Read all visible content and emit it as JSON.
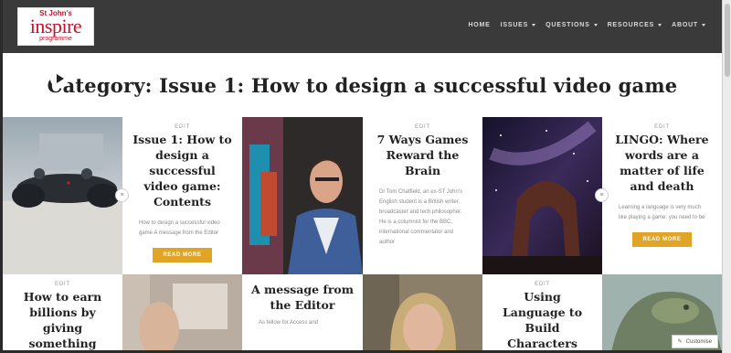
{
  "logo": {
    "line1": "St John's",
    "line2": "inspire",
    "line3": "programme"
  },
  "nav": [
    {
      "label": "HOME",
      "has_dropdown": false
    },
    {
      "label": "ISSUES",
      "has_dropdown": true
    },
    {
      "label": "QUESTIONS",
      "has_dropdown": true
    },
    {
      "label": "RESOURCES",
      "has_dropdown": true
    },
    {
      "label": "ABOUT",
      "has_dropdown": true
    }
  ],
  "page_title": "Category: Issue 1: How to design a successful video game",
  "posts": [
    {
      "edit": "EDIT",
      "title": "Issue 1: How to design a successful video game: Contents",
      "excerpt": "How to design a successful video game A message from the Editor",
      "button": "READ MORE"
    },
    {
      "edit": "EDIT",
      "title": "7 Ways Games Reward the Brain",
      "excerpt": "Dr Tom Chatfield, an ex-ST John's English student is a British writer, broadcaster and tech philosopher. He is a columnist for the BBC, international commentator and author"
    },
    {
      "edit": "EDIT",
      "title": "LINGO: Where words are a matter of life and death",
      "excerpt": "Learning a language is very much like playing a game: you need to be strategic, know how to",
      "button": "READ MORE"
    },
    {
      "edit": "EDIT",
      "title": "How to earn billions by giving something"
    },
    {
      "edit": "",
      "title": "A message from the Editor",
      "excerpt": "As fellow for Access and"
    },
    {
      "edit": "EDIT",
      "title": "Using Language to Build Characters"
    }
  ],
  "customize_label": "Customise",
  "colors": {
    "nav_bg": "#3a3a3a",
    "accent": "#e0a526",
    "logo_red": "#c8102e"
  },
  "icons": [
    "chevron-down-icon",
    "play-icon",
    "format-icon",
    "pencil-icon"
  ]
}
